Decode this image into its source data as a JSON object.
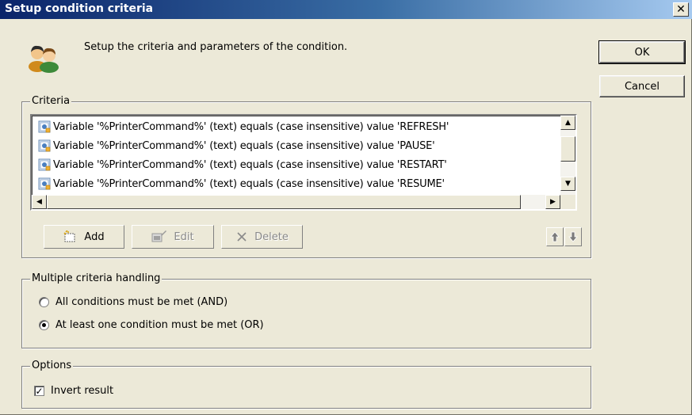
{
  "window": {
    "title": "Setup condition criteria",
    "close_glyph": "✕"
  },
  "header": {
    "description": "Setup the criteria and parameters of the condition.",
    "icon": "users-icon"
  },
  "buttons": {
    "ok": "OK",
    "cancel": "Cancel"
  },
  "criteria": {
    "legend": "Criteria",
    "items": [
      "Variable '%PrinterCommand%' (text) equals (case insensitive) value 'REFRESH'",
      "Variable '%PrinterCommand%' (text) equals (case insensitive) value 'PAUSE'",
      "Variable '%PrinterCommand%' (text) equals (case insensitive) value 'RESTART'",
      "Variable '%PrinterCommand%' (text) equals (case insensitive) value 'RESUME'"
    ],
    "toolbar": {
      "add": "Add",
      "edit": "Edit",
      "delete": "Delete"
    }
  },
  "multiple": {
    "legend": "Multiple criteria handling",
    "options": [
      {
        "label": "All conditions must be met (AND)",
        "selected": false
      },
      {
        "label": "At least one condition must be met (OR)",
        "selected": true
      }
    ]
  },
  "options": {
    "legend": "Options",
    "invert_label": "Invert result",
    "invert_checked": true
  }
}
